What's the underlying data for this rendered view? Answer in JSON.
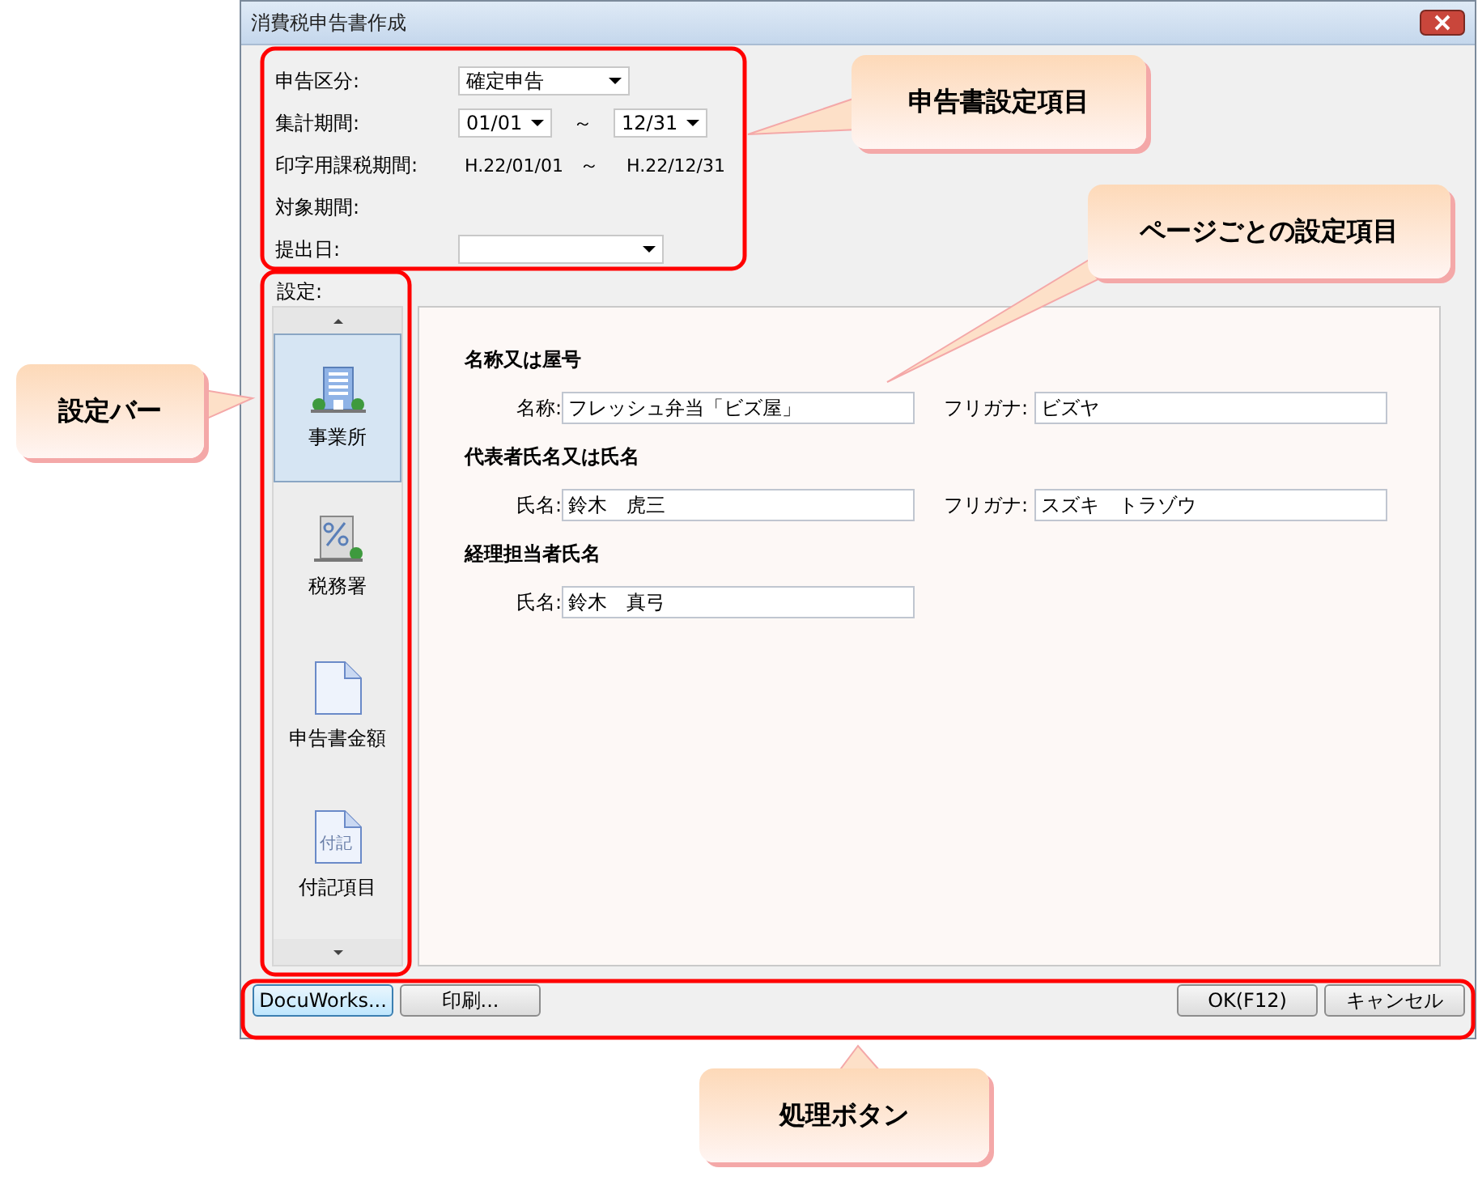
{
  "window": {
    "title": "消費税申告書作成"
  },
  "form": [
    {
      "label": "申告区分:",
      "kind": "select",
      "value": "確定申告"
    },
    {
      "label": "集計期間:",
      "kind": "range",
      "from": "01/01",
      "separator": "～",
      "to": "12/31"
    },
    {
      "label": "印字用課税期間:",
      "kind": "text-range",
      "from": "H.22/01/01",
      "separator": "～",
      "to": "H.22/12/31"
    },
    {
      "label": "対象期間:",
      "kind": "label"
    },
    {
      "label": "提出日:",
      "kind": "select"
    }
  ],
  "sidebar": {
    "label": "設定:",
    "items": [
      {
        "label": "事業所",
        "kind": "office",
        "selected": true
      },
      {
        "label": "税務署",
        "kind": "tax",
        "selected": false
      },
      {
        "label": "申告書金額",
        "kind": "document",
        "selected": false
      },
      {
        "label": "付記項目",
        "kind": "note",
        "icon_text": "付記",
        "selected": false
      }
    ]
  },
  "sections": [
    {
      "heading": "名称又は屋号",
      "fields": [
        {
          "label": "名称:",
          "value": "フレッシュ弁当「ビズ屋」",
          "kana_label": "フリガナ:",
          "kana": "ビズヤ"
        }
      ]
    },
    {
      "heading": "代表者氏名又は氏名",
      "fields": [
        {
          "label": "氏名:",
          "value": "鈴木　虎三",
          "kana_label": "フリガナ:",
          "kana": "スズキ　トラゾウ"
        }
      ]
    },
    {
      "heading": "経理担当者氏名",
      "fields": [
        {
          "label": "氏名:",
          "value": "鈴木　真弓"
        }
      ]
    }
  ],
  "buttons": {
    "left": [
      {
        "label": "DocuWorks...",
        "focused": true
      },
      {
        "label": "印刷...",
        "focused": false
      }
    ],
    "right": [
      {
        "label": "OK(F12)",
        "focused": false
      },
      {
        "label": "キャンセル",
        "focused": false
      }
    ]
  },
  "callouts": [
    {
      "text": "申告書設定項目"
    },
    {
      "text": "ページごとの設定項目"
    },
    {
      "text": "設定バー"
    },
    {
      "text": "処理ボタン"
    }
  ]
}
